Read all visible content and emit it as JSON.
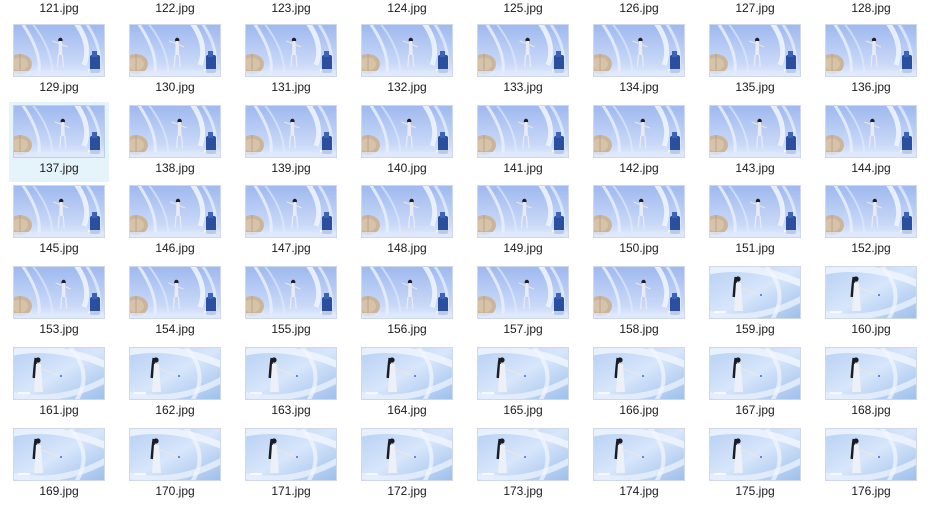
{
  "window": {
    "view": "Large icons",
    "selected_file": "137.jpg"
  },
  "header_row_labels": [
    "121.jpg",
    "122.jpg",
    "123.jpg",
    "124.jpg",
    "125.jpg",
    "126.jpg",
    "127.jpg",
    "128.jpg"
  ],
  "files": [
    {
      "name": "129.jpg",
      "scene": "umbrella"
    },
    {
      "name": "130.jpg",
      "scene": "umbrella"
    },
    {
      "name": "131.jpg",
      "scene": "umbrella"
    },
    {
      "name": "132.jpg",
      "scene": "umbrella"
    },
    {
      "name": "133.jpg",
      "scene": "umbrella"
    },
    {
      "name": "134.jpg",
      "scene": "umbrella"
    },
    {
      "name": "135.jpg",
      "scene": "umbrella"
    },
    {
      "name": "136.jpg",
      "scene": "umbrella"
    },
    {
      "name": "137.jpg",
      "scene": "umbrella"
    },
    {
      "name": "138.jpg",
      "scene": "umbrella"
    },
    {
      "name": "139.jpg",
      "scene": "umbrella"
    },
    {
      "name": "140.jpg",
      "scene": "umbrella"
    },
    {
      "name": "141.jpg",
      "scene": "umbrella"
    },
    {
      "name": "142.jpg",
      "scene": "umbrella"
    },
    {
      "name": "143.jpg",
      "scene": "umbrella"
    },
    {
      "name": "144.jpg",
      "scene": "umbrella"
    },
    {
      "name": "145.jpg",
      "scene": "umbrella"
    },
    {
      "name": "146.jpg",
      "scene": "umbrella"
    },
    {
      "name": "147.jpg",
      "scene": "umbrella"
    },
    {
      "name": "148.jpg",
      "scene": "umbrella"
    },
    {
      "name": "149.jpg",
      "scene": "umbrella"
    },
    {
      "name": "150.jpg",
      "scene": "umbrella"
    },
    {
      "name": "151.jpg",
      "scene": "umbrella"
    },
    {
      "name": "152.jpg",
      "scene": "umbrella"
    },
    {
      "name": "153.jpg",
      "scene": "umbrella"
    },
    {
      "name": "154.jpg",
      "scene": "umbrella"
    },
    {
      "name": "155.jpg",
      "scene": "umbrella"
    },
    {
      "name": "156.jpg",
      "scene": "umbrella"
    },
    {
      "name": "157.jpg",
      "scene": "umbrella"
    },
    {
      "name": "158.jpg",
      "scene": "umbrella"
    },
    {
      "name": "159.jpg",
      "scene": "ribbon"
    },
    {
      "name": "160.jpg",
      "scene": "ribbon"
    },
    {
      "name": "161.jpg",
      "scene": "ribbon"
    },
    {
      "name": "162.jpg",
      "scene": "ribbon"
    },
    {
      "name": "163.jpg",
      "scene": "ribbon"
    },
    {
      "name": "164.jpg",
      "scene": "ribbon"
    },
    {
      "name": "165.jpg",
      "scene": "ribbon"
    },
    {
      "name": "166.jpg",
      "scene": "ribbon"
    },
    {
      "name": "167.jpg",
      "scene": "ribbon"
    },
    {
      "name": "168.jpg",
      "scene": "ribbon"
    },
    {
      "name": "169.jpg",
      "scene": "ribbon"
    },
    {
      "name": "170.jpg",
      "scene": "ribbon"
    },
    {
      "name": "171.jpg",
      "scene": "ribbon"
    },
    {
      "name": "172.jpg",
      "scene": "ribbon"
    },
    {
      "name": "173.jpg",
      "scene": "ribbon"
    },
    {
      "name": "174.jpg",
      "scene": "ribbon"
    },
    {
      "name": "175.jpg",
      "scene": "ribbon"
    },
    {
      "name": "176.jpg",
      "scene": "ribbon"
    }
  ],
  "colors": {
    "selection": "#e5f3fb",
    "text": "#1a1a1a",
    "sky": "#a9c3f2",
    "deep_blue": "#2a4f9e"
  }
}
